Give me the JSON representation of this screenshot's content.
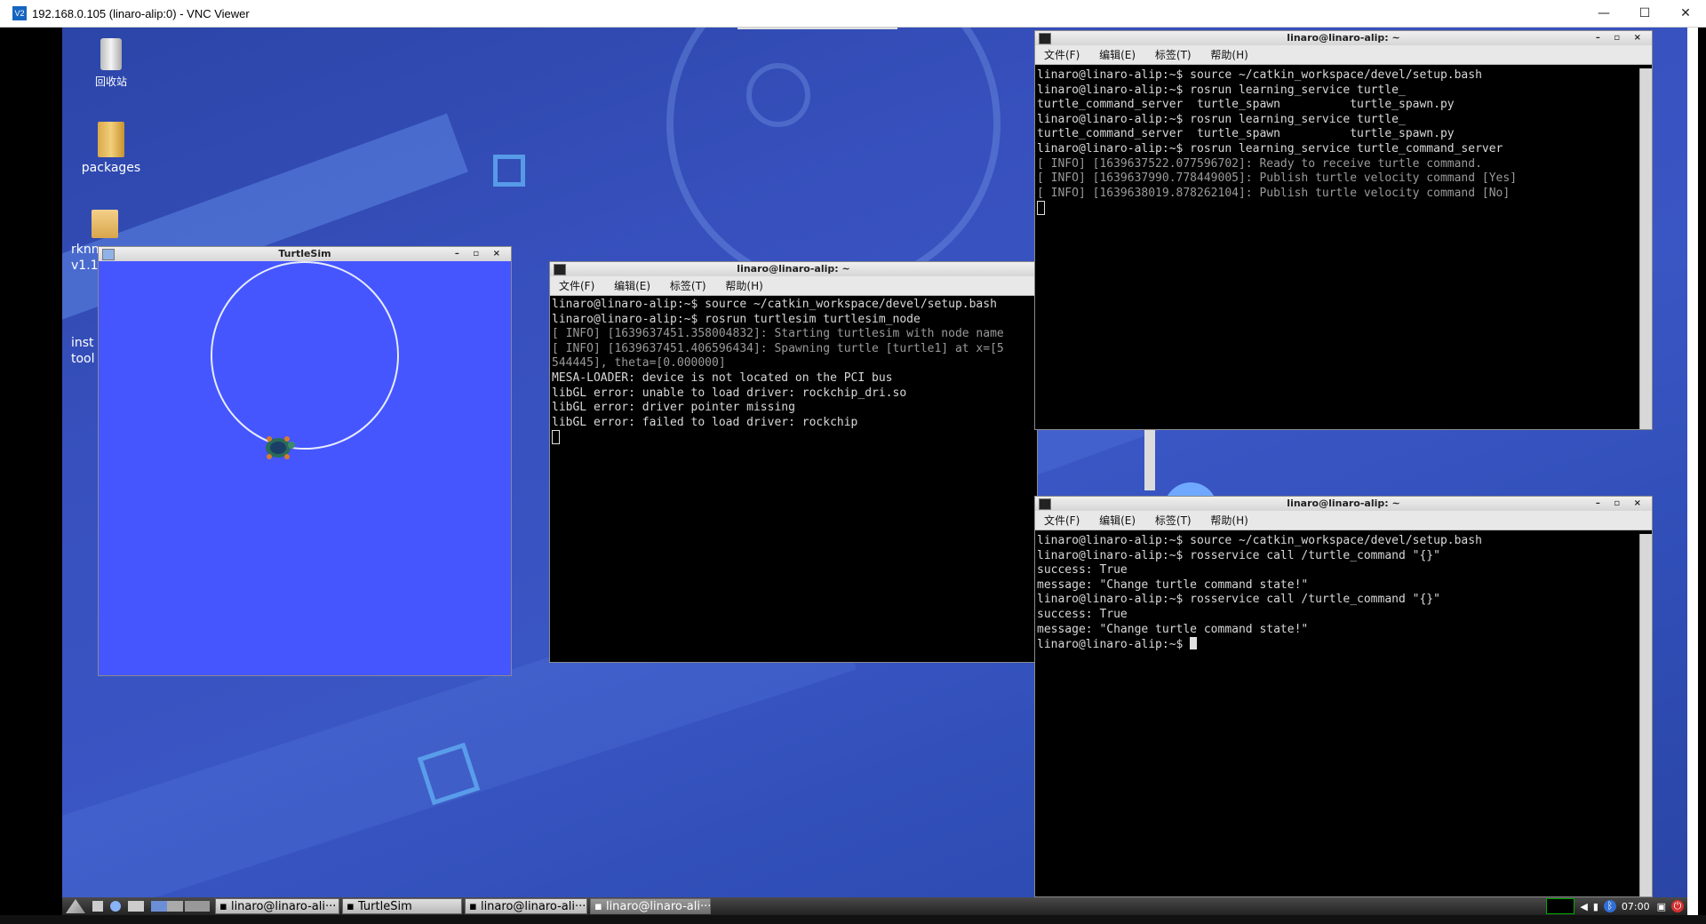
{
  "vnc": {
    "title": "192.168.0.105 (linaro-alip:0) - VNC Viewer",
    "icon_text": "V2",
    "minimize": "—",
    "maximize": "☐",
    "close": "✕"
  },
  "desktop_icons": [
    {
      "label": "回收站"
    },
    {
      "label": "packages"
    },
    {
      "label": "rknn v1.1"
    },
    {
      "label": "inst tool"
    }
  ],
  "turtlesim": {
    "title": "TurtleSim",
    "buttons": "– ▫ ×",
    "background": "#4556ff"
  },
  "menu": [
    "文件(F)",
    "编辑(E)",
    "标签(T)",
    "帮助(H)"
  ],
  "term_title": "linaro@linaro-alip: ~",
  "term_center": {
    "lines": [
      "linaro@linaro-alip:~$ source ~/catkin_workspace/devel/setup.bash",
      "linaro@linaro-alip:~$ rosrun turtlesim turtlesim_node",
      "[ INFO] [1639637451.358004832]: Starting turtlesim with node name",
      "[ INFO] [1639637451.406596434]: Spawning turtle [turtle1] at x=[5",
      "544445], theta=[0.000000]",
      "MESA-LOADER: device is not located on the PCI bus",
      "libGL error: unable to load driver: rockchip_dri.so",
      "libGL error: driver pointer missing",
      "libGL error: failed to load driver: rockchip"
    ]
  },
  "term_top_right": {
    "lines": [
      "linaro@linaro-alip:~$ source ~/catkin_workspace/devel/setup.bash",
      "linaro@linaro-alip:~$ rosrun learning_service turtle_",
      "turtle_command_server  turtle_spawn          turtle_spawn.py",
      "linaro@linaro-alip:~$ rosrun learning_service turtle_",
      "turtle_command_server  turtle_spawn          turtle_spawn.py",
      "linaro@linaro-alip:~$ rosrun learning_service turtle_command_server",
      "[ INFO] [1639637522.077596702]: Ready to receive turtle command.",
      "[ INFO] [1639637990.778449005]: Publish turtle velocity command [Yes]",
      "[ INFO] [1639638019.878262104]: Publish turtle velocity command [No]"
    ]
  },
  "term_bottom_right": {
    "lines": [
      "linaro@linaro-alip:~$ source ~/catkin_workspace/devel/setup.bash",
      "linaro@linaro-alip:~$ rosservice call /turtle_command \"{}\"",
      "success: True",
      "message: \"Change turtle command state!\"",
      "linaro@linaro-alip:~$ rosservice call /turtle_command \"{}\"",
      "success: True",
      "message: \"Change turtle command state!\"",
      "linaro@linaro-alip:~$ "
    ]
  },
  "taskbar": {
    "tasks": [
      "linaro@linaro-ali···",
      "TurtleSim",
      "linaro@linaro-ali···",
      "linaro@linaro-ali···"
    ],
    "clock": "07:00"
  }
}
